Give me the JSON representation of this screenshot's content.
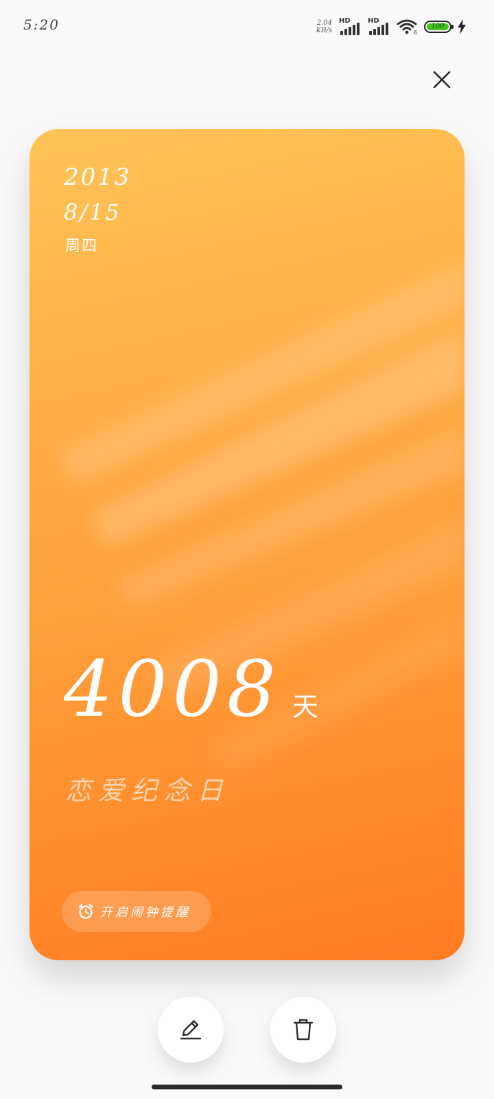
{
  "status_bar": {
    "time": "5:20",
    "net_speed_value": "2.04",
    "net_speed_unit": "KB/s",
    "signal_1_label": "HD",
    "signal_2_label": "HD",
    "wifi_badge": "6",
    "battery_level": "100",
    "battery_color": "#43c31c"
  },
  "card": {
    "year": "2013",
    "date": "8/15",
    "weekday": "周四",
    "days_count": "4008",
    "days_unit": "天",
    "event_name": "恋爱纪念日",
    "alarm_label": "开启闹钟提醒",
    "gradient_top": "#ffc458",
    "gradient_bottom": "#ff7b22"
  },
  "icons": {
    "close": "close-icon",
    "alarm": "alarm-clock-icon",
    "edit": "pencil-icon",
    "delete": "trash-icon"
  }
}
